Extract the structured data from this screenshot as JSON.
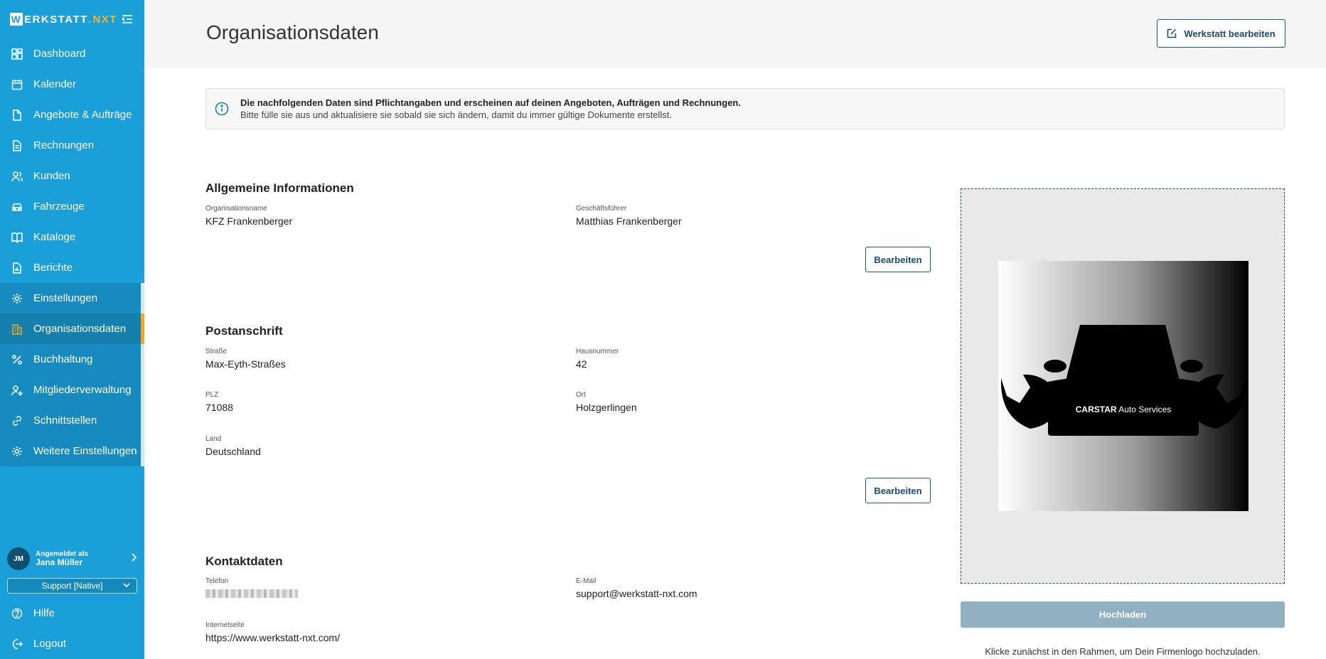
{
  "brand": {
    "prefix": "W",
    "name": "ERKSTATT",
    "accent": "NXT"
  },
  "nav": {
    "items": [
      {
        "label": "Dashboard",
        "icon": "dashboard-icon"
      },
      {
        "label": "Kalender",
        "icon": "calendar-icon"
      },
      {
        "label": "Angebote & Aufträge",
        "icon": "document-icon"
      },
      {
        "label": "Rechnungen",
        "icon": "invoice-icon"
      },
      {
        "label": "Kunden",
        "icon": "users-icon"
      },
      {
        "label": "Fahrzeuge",
        "icon": "car-icon"
      },
      {
        "label": "Kataloge",
        "icon": "book-icon"
      },
      {
        "label": "Berichte",
        "icon": "report-icon"
      }
    ],
    "settings": [
      {
        "label": "Einstellungen",
        "icon": "gear-icon"
      },
      {
        "label": "Organisationsdaten",
        "icon": "building-icon",
        "active": true
      },
      {
        "label": "Buchhaltung",
        "icon": "percent-icon"
      },
      {
        "label": "Mitgliederverwaltung",
        "icon": "user-gear-icon"
      },
      {
        "label": "Schnittstellen",
        "icon": "link-icon"
      },
      {
        "label": "Weitere Einstellungen",
        "icon": "gear-icon"
      }
    ]
  },
  "user": {
    "initials": "JM",
    "label": "Angemeldet als",
    "name": "Jana Müller",
    "role_selected": "Support [Native]"
  },
  "bottom_nav": [
    {
      "label": "Hilfe",
      "icon": "help-icon"
    },
    {
      "label": "Logout",
      "icon": "logout-icon"
    }
  ],
  "page": {
    "title": "Organisationsdaten",
    "edit_workshop_label": "Werkstatt bearbeiten"
  },
  "info": {
    "title": "Die nachfolgenden Daten sind Pflichtangaben und erscheinen auf deinen Angeboten, Aufträgen und Rechnungen.",
    "subtitle": "Bitte fülle sie aus und aktualisiere sie sobald sie sich ändern, damit du immer gültige Dokumente erstellst."
  },
  "general": {
    "title": "Allgemeine Informationen",
    "org_name_label": "Organisationsname",
    "org_name_value": "KFZ Frankenberger",
    "ceo_label": "Geschäftsführer",
    "ceo_value": "Matthias Frankenberger",
    "edit_label": "Bearbeiten"
  },
  "address": {
    "title": "Postanschrift",
    "street_label": "Straße",
    "street_value": "Max-Eyth-Straßes",
    "number_label": "Hausnummer",
    "number_value": "42",
    "zip_label": "PLZ",
    "zip_value": "71088",
    "city_label": "Ort",
    "city_value": "Holzgerlingen",
    "country_label": "Land",
    "country_value": "Deutschland",
    "edit_label": "Bearbeiten"
  },
  "contact": {
    "title": "Kontaktdaten",
    "phone_label": "Telefon",
    "email_label": "E-Mail",
    "email_value": "support@werkstatt-nxt.com",
    "website_label": "Internetseite",
    "website_value": "https://www.werkstatt-nxt.com/"
  },
  "logo": {
    "brand_bold": "CARSTAR",
    "brand_rest": " Auto Services",
    "upload_label": "Hochladen",
    "upload_hint": "Klicke zunächst in den Rahmen, um Dein Firmenlogo hochzuladen."
  },
  "colors": {
    "sidebar": "#1a9fd9",
    "accent": "#f5a623",
    "primary_dark": "#1a5b85"
  }
}
